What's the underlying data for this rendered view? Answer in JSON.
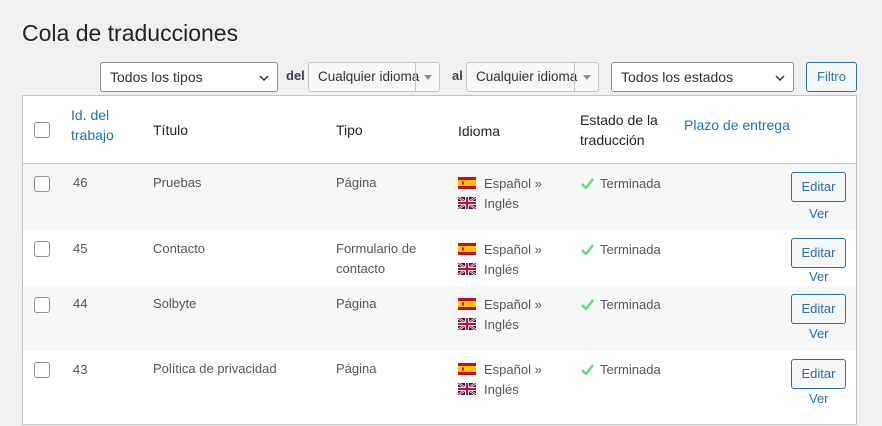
{
  "page": {
    "title": "Cola de traducciones"
  },
  "filters": {
    "type_select": "Todos los tipos",
    "from_label": "del",
    "from_lang": "Cualquier idioma",
    "to_label": "al",
    "to_lang": "Cualquier idioma",
    "status_select": "Todos los estados",
    "filter_button": "Filtro"
  },
  "table": {
    "headers": {
      "job_id_line1": "Id. del",
      "job_id_line2": "trabajo",
      "title": "Título",
      "type": "Tipo",
      "language": "Idioma",
      "status_line1": "Estado de la",
      "status_line2": "traducción",
      "deadline": "Plazo de entrega"
    },
    "rows": [
      {
        "id": "46",
        "title": "Pruebas",
        "type_line1": "Página",
        "type_line2": "",
        "from": "Español »",
        "to": "Inglés",
        "status": "Terminada",
        "edit": "Editar",
        "view": "Ver"
      },
      {
        "id": "45",
        "title": "Contacto",
        "type_line1": "Formulario de",
        "type_line2": "contacto",
        "from": "Español »",
        "to": "Inglés",
        "status": "Terminada",
        "edit": "Editar",
        "view": "Ver"
      },
      {
        "id": "44",
        "title": "Solbyte",
        "type_line1": "Página",
        "type_line2": "",
        "from": "Español »",
        "to": "Inglés",
        "status": "Terminada",
        "edit": "Editar",
        "view": "Ver"
      },
      {
        "id": "43",
        "title": "Política de privacidad",
        "type_line1": "Página",
        "type_line2": "",
        "from": "Español »",
        "to": "Inglés",
        "status": "Terminada",
        "edit": "Editar",
        "view": "Ver"
      }
    ]
  },
  "icons": {
    "from_flag": "spain-flag-icon",
    "to_flag": "uk-flag-icon",
    "status_icon": "checkmark-icon",
    "select_arrow": "chevron-down-icon"
  },
  "colors": {
    "link": "#2271b1",
    "success": "#68de7c",
    "border": "#c3c4c7",
    "background": "#f0f0f1"
  }
}
